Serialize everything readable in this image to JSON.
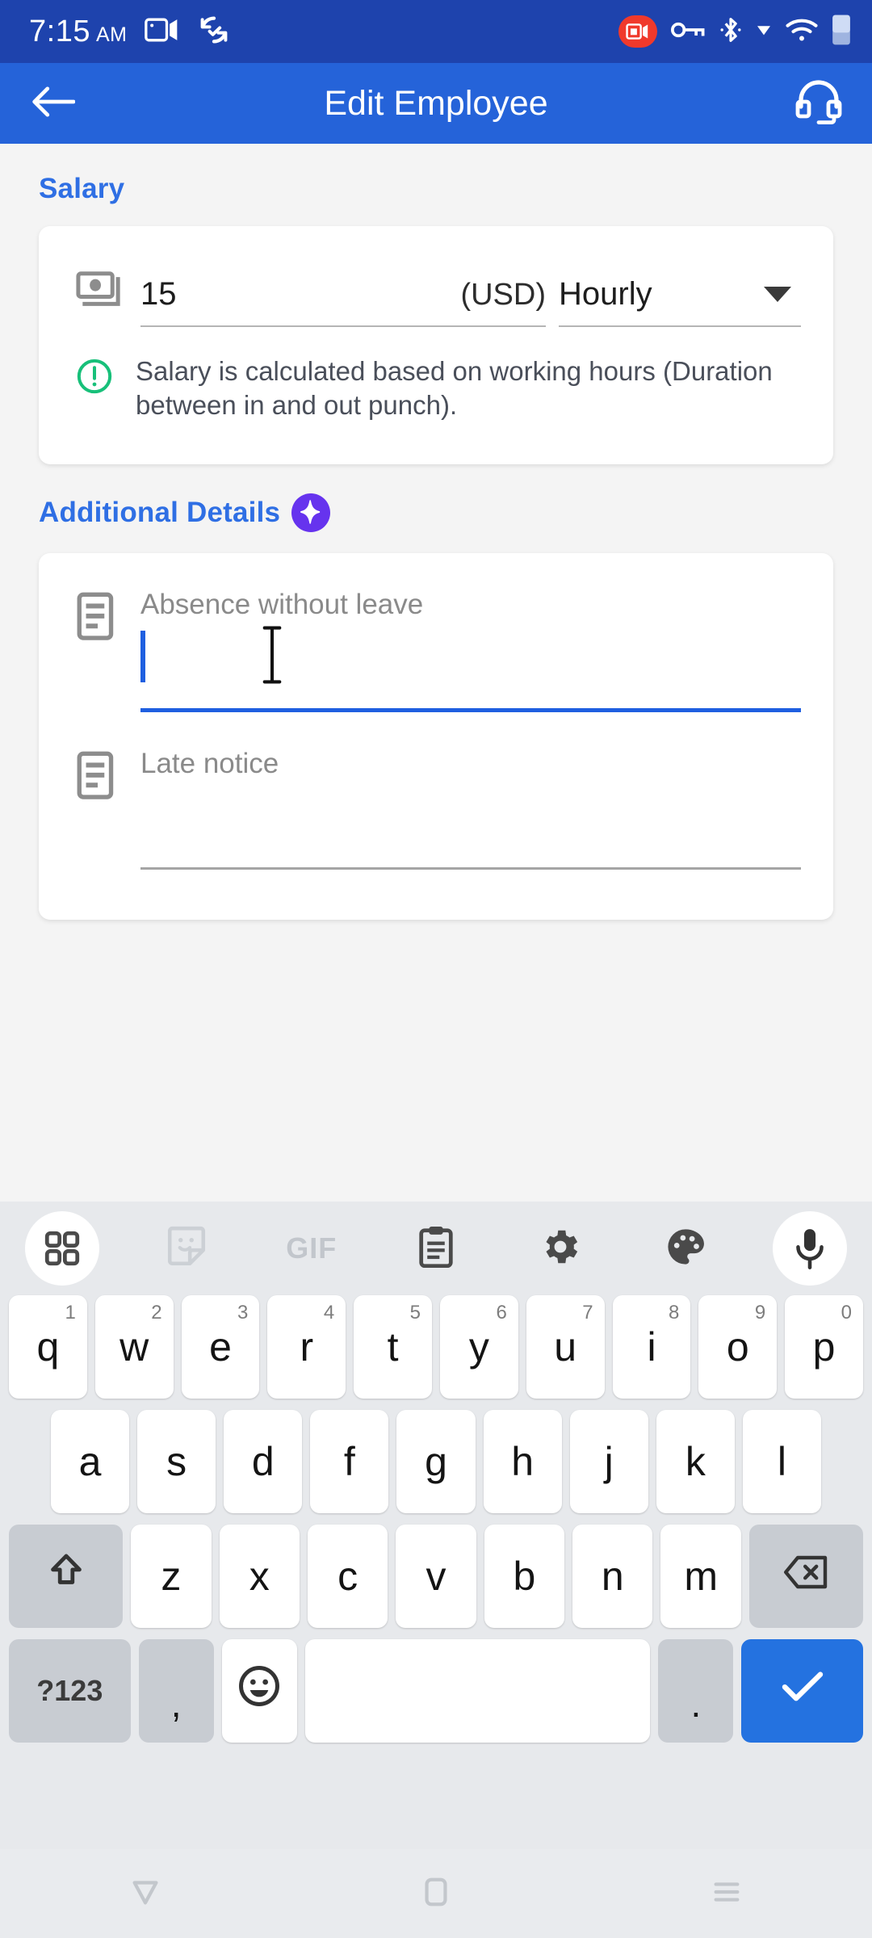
{
  "status_bar": {
    "time": "7:15",
    "ampm": "AM",
    "icons": [
      "screen-cast-icon",
      "sync-check-icon"
    ],
    "right_icons": [
      "screen-record-badge",
      "vpn-key-icon",
      "bluetooth-icon",
      "wifi-down-arrow-icon",
      "wifi-icon",
      "battery-icon"
    ],
    "background": "#1e43ad"
  },
  "app_bar": {
    "title": "Edit Employee",
    "back_icon": "arrow-left-icon",
    "support_icon": "headset-icon",
    "background": "#2563d9"
  },
  "salary": {
    "section_title": "Salary",
    "amount_icon": "money-stack-icon",
    "amount": "15",
    "currency": "(USD)",
    "pay_type": "Hourly",
    "dropdown_icon": "caret-down-icon",
    "note_icon": "exclamation-circle-icon",
    "note_icon_color": "#18c07a",
    "note": "Salary is calculated based on working hours (Duration between in and out punch)."
  },
  "additional_details": {
    "section_title": "Additional Details",
    "badge_icon": "sparkle-badge-icon",
    "badge_color": "#6633ee",
    "fields": [
      {
        "icon": "document-lines-icon",
        "label": "Absence without leave",
        "value": "",
        "focused": true
      },
      {
        "icon": "document-lines-icon",
        "label": "Late notice",
        "value": "",
        "focused": false
      }
    ]
  },
  "keyboard": {
    "toolbar": [
      {
        "icon": "apps-grid-icon",
        "circle": true
      },
      {
        "icon": "sticker-icon",
        "circle": false
      },
      {
        "icon": "gif-icon",
        "label": "GIF",
        "circle": false
      },
      {
        "icon": "clipboard-icon",
        "circle": false
      },
      {
        "icon": "gear-icon",
        "circle": false
      },
      {
        "icon": "palette-icon",
        "circle": false
      },
      {
        "icon": "microphone-icon",
        "circle": true
      }
    ],
    "row1": [
      {
        "key": "q",
        "sup": "1"
      },
      {
        "key": "w",
        "sup": "2"
      },
      {
        "key": "e",
        "sup": "3"
      },
      {
        "key": "r",
        "sup": "4"
      },
      {
        "key": "t",
        "sup": "5"
      },
      {
        "key": "y",
        "sup": "6"
      },
      {
        "key": "u",
        "sup": "7"
      },
      {
        "key": "i",
        "sup": "8"
      },
      {
        "key": "o",
        "sup": "9"
      },
      {
        "key": "p",
        "sup": "0"
      }
    ],
    "row2": [
      "a",
      "s",
      "d",
      "f",
      "g",
      "h",
      "j",
      "k",
      "l"
    ],
    "row3": [
      "z",
      "x",
      "c",
      "v",
      "b",
      "n",
      "m"
    ],
    "shift_icon": "shift-arrow-icon",
    "backspace_icon": "backspace-icon",
    "symbols_label": "?123",
    "comma_label": ",",
    "emoji_icon": "emoji-smiley-icon",
    "space_label": "",
    "period_label": ".",
    "enter_icon": "checkmark-icon",
    "enter_color": "#2472e0"
  },
  "nav_bar": {
    "back_icon": "triangle-back-icon",
    "home_icon": "home-square-icon",
    "recents_icon": "recents-lines-icon"
  }
}
